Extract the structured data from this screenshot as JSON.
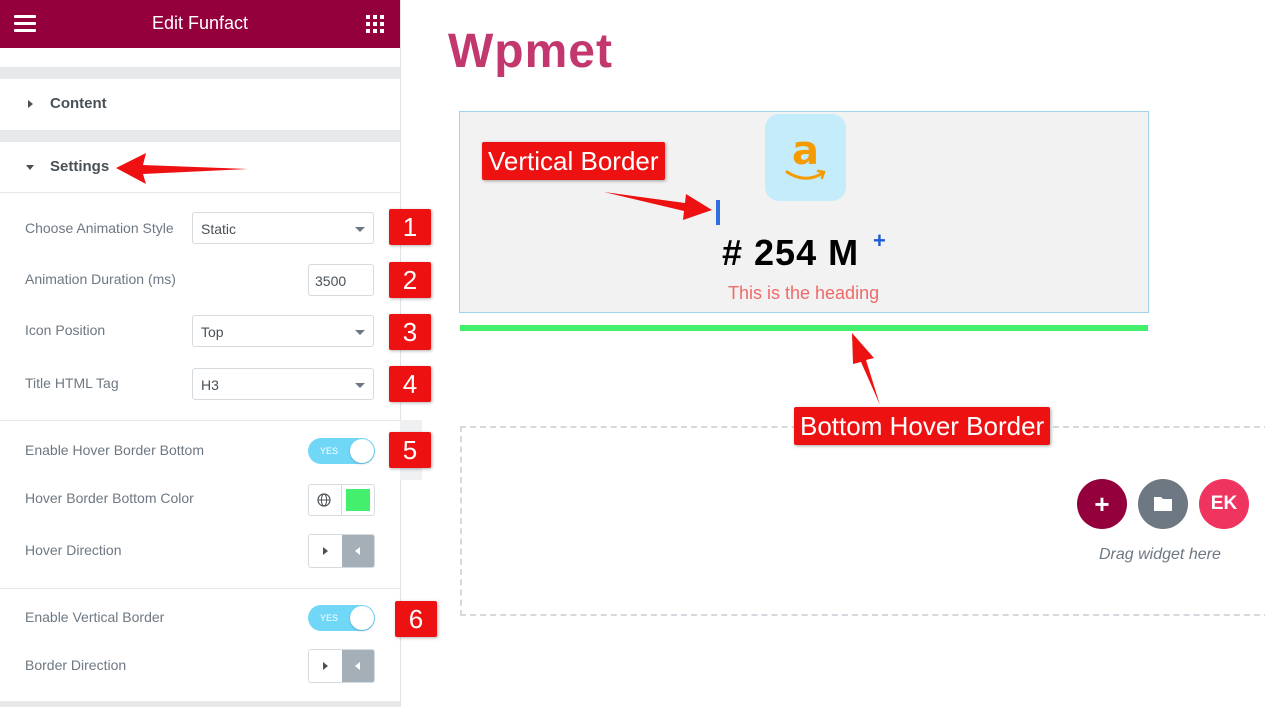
{
  "panel": {
    "title": "Edit Funfact",
    "sections": {
      "content": "Content",
      "settings": "Settings"
    }
  },
  "settings": {
    "animation_style": {
      "label": "Choose Animation Style",
      "value": "Static"
    },
    "animation_duration": {
      "label": "Animation Duration (ms)",
      "value": "3500"
    },
    "icon_position": {
      "label": "Icon Position",
      "value": "Top"
    },
    "title_tag": {
      "label": "Title HTML Tag",
      "value": "H3"
    },
    "hover_border_bottom": {
      "label": "Enable Hover Border Bottom",
      "toggle": "YES"
    },
    "hover_border_color": {
      "label": "Hover Border Bottom Color",
      "color": "#45ef6e"
    },
    "hover_direction": {
      "label": "Hover Direction"
    },
    "vertical_border": {
      "label": "Enable Vertical Border",
      "toggle": "YES"
    },
    "border_direction": {
      "label": "Border Direction"
    }
  },
  "markers": [
    "1",
    "2",
    "3",
    "4",
    "5",
    "6"
  ],
  "canvas": {
    "brand": "Wpmet",
    "funfact": {
      "icon_letter": "a",
      "count": "# 254  M",
      "suffix": "+",
      "heading": "This is the heading"
    },
    "drop_zone": {
      "drag_text": "Drag widget here"
    }
  },
  "callouts": {
    "vertical": "Vertical Border",
    "bottom": "Bottom Hover Border"
  },
  "colors": {
    "brand": "#93003c",
    "accent": "#c2386e",
    "callout": "#ee1111",
    "toggle_on": "#71d7f7"
  },
  "icons": [
    "hamburger-icon",
    "apps-grid-icon",
    "globe-icon",
    "folder-icon",
    "elementskit-icon",
    "plus-icon",
    "amazon-icon"
  ]
}
